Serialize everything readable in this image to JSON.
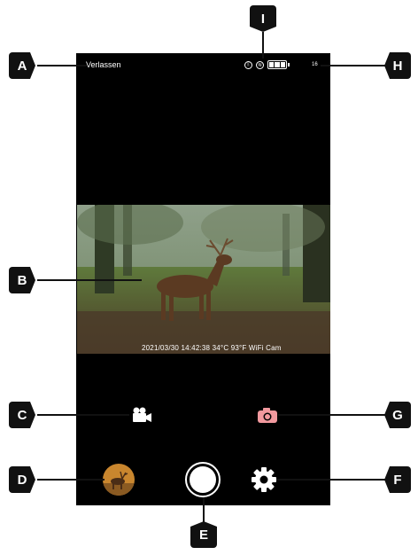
{
  "status_bar": {
    "exit_label": "Verlassen",
    "right_number": "16",
    "battery_level": 1.0
  },
  "preview": {
    "timestamp_overlay": "2021/03/30   14:42:38   34°C 93°F   WiFi Cam"
  },
  "controls": {
    "video_icon": "video-camera-icon",
    "photo_icon": "photo-camera-icon",
    "gallery_icon": "gallery-thumbnail-icon",
    "shutter_icon": "shutter-icon",
    "settings_icon": "gear-icon"
  },
  "markers": {
    "A": "A",
    "B": "B",
    "C": "C",
    "D": "D",
    "E": "E",
    "F": "F",
    "G": "G",
    "H": "H",
    "I": "I"
  },
  "colors": {
    "screen_bg": "#000000",
    "photo_button": "#f2999e",
    "marker_bg": "#111111"
  }
}
